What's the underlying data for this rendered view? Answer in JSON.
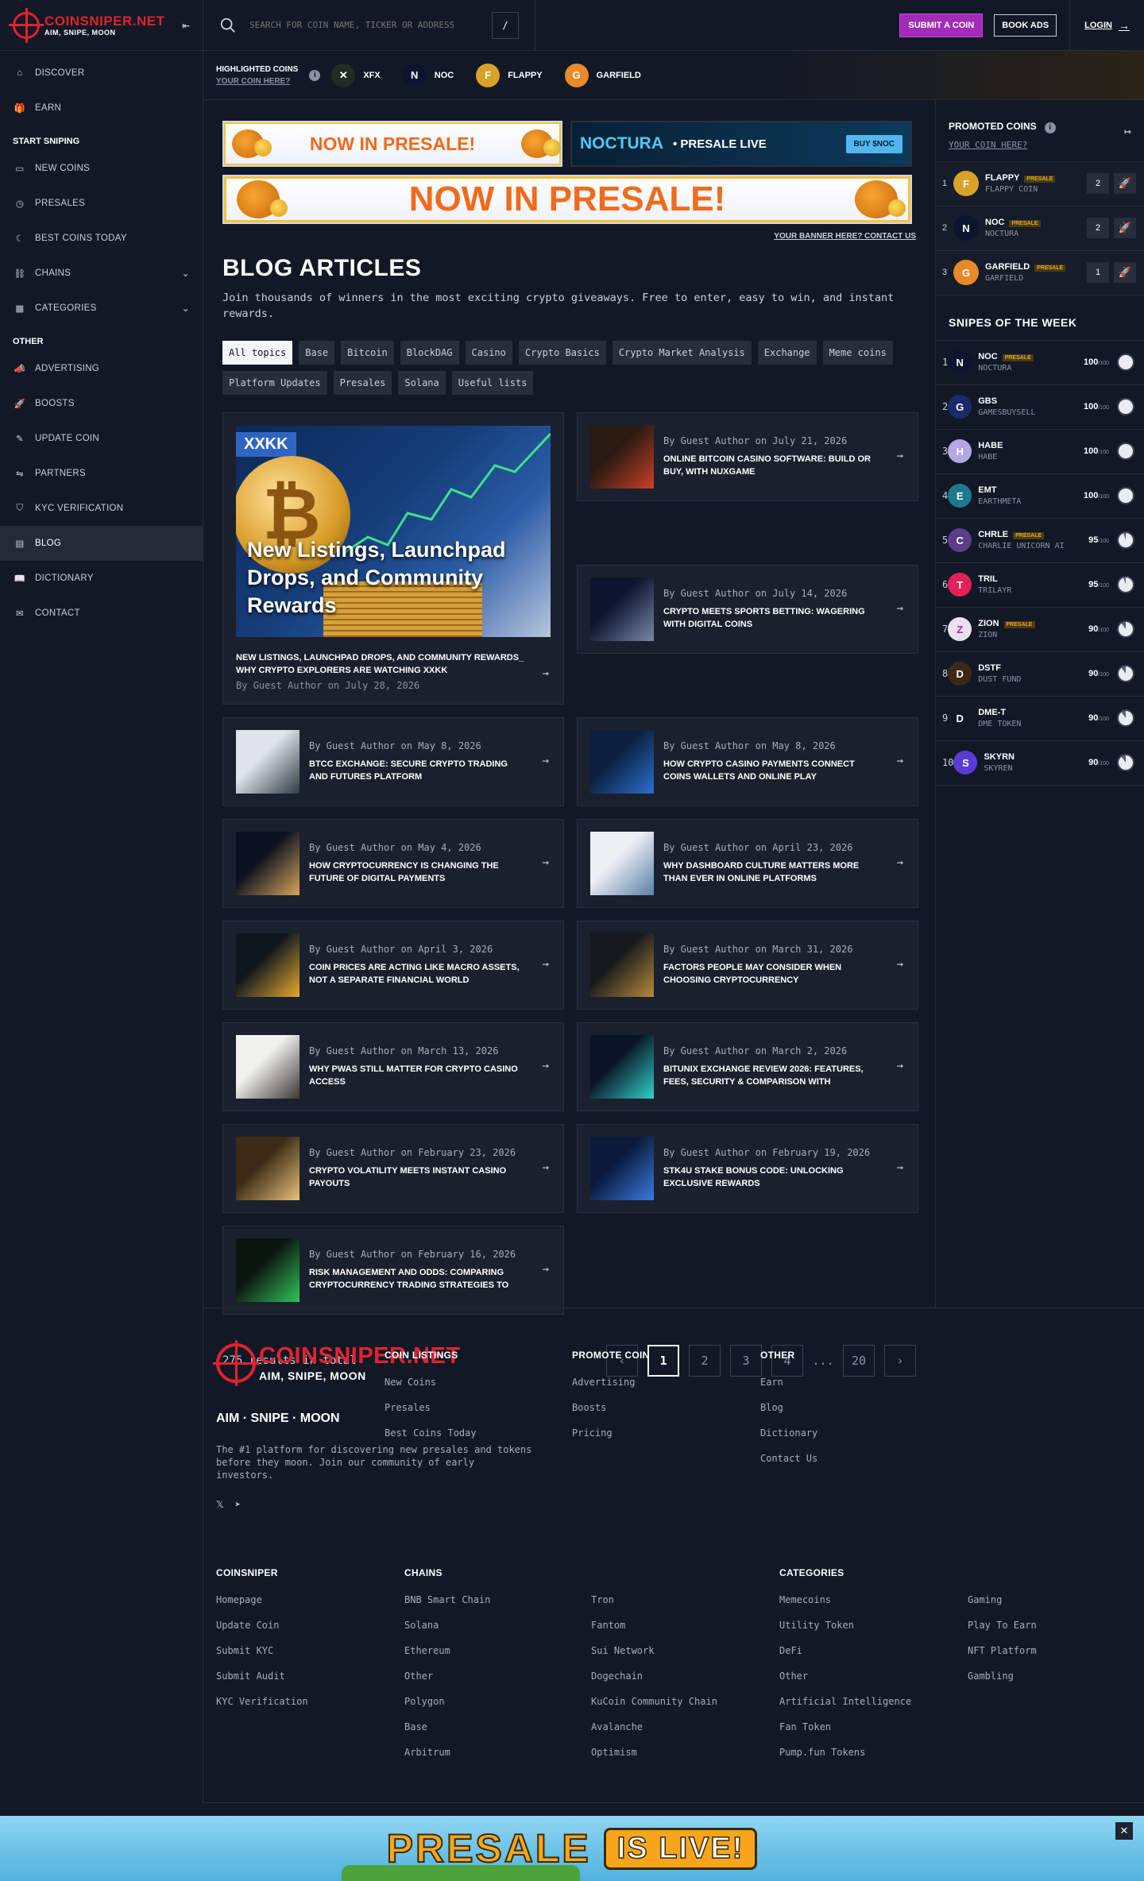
{
  "brand": {
    "name": "COINSNIPER.NET",
    "tagline": "AIM, SNIPE, MOON"
  },
  "sidebar": {
    "items_top": [
      {
        "label": "DISCOVER",
        "icon": "home-icon"
      },
      {
        "label": "EARN",
        "icon": "gift-icon"
      }
    ],
    "section_sniping": "START SNIPING",
    "items_sniping": [
      {
        "label": "NEW COINS",
        "icon": "new-icon"
      },
      {
        "label": "PRESALES",
        "icon": "stopwatch-icon"
      },
      {
        "label": "BEST COINS TODAY",
        "icon": "moon-icon"
      },
      {
        "label": "CHAINS",
        "icon": "link-icon"
      },
      {
        "label": "CATEGORIES",
        "icon": "grid-icon"
      }
    ],
    "section_other": "OTHER",
    "items_other": [
      {
        "label": "ADVERTISING",
        "icon": "megaphone-icon"
      },
      {
        "label": "BOOSTS",
        "icon": "rocket-icon"
      },
      {
        "label": "UPDATE COIN",
        "icon": "edit-icon"
      },
      {
        "label": "PARTNERS",
        "icon": "handshake-icon"
      },
      {
        "label": "KYC VERIFICATION",
        "icon": "shield-icon"
      },
      {
        "label": "BLOG",
        "icon": "document-icon"
      },
      {
        "label": "DICTIONARY",
        "icon": "book-icon"
      },
      {
        "label": "CONTACT",
        "icon": "mail-icon"
      }
    ]
  },
  "topbar": {
    "search_placeholder": "SEARCH FOR COIN NAME, TICKER OR ADDRESS",
    "search_shortcut": "/",
    "submit_label": "SUBMIT A COIN",
    "book_label": "BOOK ADS",
    "login_label": "LOGIN"
  },
  "highlighted": {
    "title": "HIGHLIGHTED COINS",
    "sub": "YOUR COIN HERE?",
    "coins": [
      {
        "name": "XFX",
        "color": "#1f2d22",
        "glyph": "✕"
      },
      {
        "name": "NOC",
        "color": "#0d1430",
        "glyph": "N"
      },
      {
        "name": "FLAPPY",
        "color": "#d8a328",
        "glyph": "F"
      },
      {
        "name": "GARFIELD",
        "color": "#e8892a",
        "glyph": "G"
      }
    ]
  },
  "banners": {
    "presale_small": "NOW IN PRESALE!",
    "noc_brand": "NOCTURA",
    "noc_live": "• PRESALE LIVE",
    "noc_buy": "BUY $NOC",
    "presale_big": "NOW IN PRESALE!",
    "banner_link": "YOUR BANNER HERE? CONTACT US"
  },
  "blog": {
    "title": "BLOG ARTICLES",
    "description": "Join thousands of winners in the most exciting crypto giveaways. Free to enter, easy to win, and instant rewards.",
    "topics": [
      "All topics",
      "Base",
      "Bitcoin",
      "BlockDAG",
      "Casino",
      "Crypto Basics",
      "Crypto Market Analysis",
      "Exchange",
      "Meme coins",
      "Platform Updates",
      "Presales",
      "Solana",
      "Useful lists"
    ],
    "featured": {
      "badge": "XXKK",
      "image_caption": "New Listings, Launchpad Drops, and Community Rewards",
      "title": "NEW LISTINGS, LAUNCHPAD DROPS, AND COMMUNITY REWARDS_ WHY CRYPTO EXPLORERS ARE WATCHING XXKK",
      "meta": "By Guest Author on July 28, 2026"
    },
    "articles": [
      {
        "meta": "By Guest Author on July 21, 2026",
        "title": "ONLINE BITCOIN CASINO SOFTWARE: BUILD OR BUY, WITH NUXGAME",
        "thumb": [
          "#2a1a10",
          "#c8402a"
        ]
      },
      {
        "meta": "By Guest Author on July 14, 2026",
        "title": "CRYPTO MEETS SPORTS BETTING: WAGERING WITH DIGITAL COINS",
        "thumb": [
          "#0d1530",
          "#7a86a8"
        ]
      },
      {
        "meta": "By Guest Author on May 8, 2026",
        "title": "BTCC EXCHANGE: SECURE CRYPTO TRADING AND FUTURES PLATFORM",
        "thumb": [
          "#dfe5ea",
          "#2f3a44"
        ]
      },
      {
        "meta": "By Guest Author on May 8, 2026",
        "title": "HOW CRYPTO CASINO PAYMENTS CONNECT COINS WALLETS AND ONLINE PLAY",
        "thumb": [
          "#0b1f3e",
          "#2c6fd0"
        ]
      },
      {
        "meta": "By Guest Author on May 4, 2026",
        "title": "HOW CRYPTOCURRENCY IS CHANGING THE FUTURE OF DIGITAL PAYMENTS",
        "thumb": [
          "#0a1020",
          "#d7a55a"
        ]
      },
      {
        "meta": "By Guest Author on April 23, 2026",
        "title": "WHY DASHBOARD CULTURE MATTERS MORE THAN EVER IN ONLINE PLATFORMS",
        "thumb": [
          "#eef1f4",
          "#5a7fa8"
        ]
      },
      {
        "meta": "By Guest Author on April 3, 2026",
        "title": "COIN PRICES ARE ACTING LIKE MACRO ASSETS, NOT A SEPARATE FINANCIAL WORLD",
        "thumb": [
          "#10161e",
          "#e6a92e"
        ]
      },
      {
        "meta": "By Guest Author on March 31, 2026",
        "title": "FACTORS PEOPLE MAY CONSIDER WHEN CHOOSING CRYPTOCURRENCY",
        "thumb": [
          "#15171c",
          "#b88a3a"
        ]
      },
      {
        "meta": "By Guest Author on March 13, 2026",
        "title": "WHY PWAS STILL MATTER FOR CRYPTO CASINO ACCESS",
        "thumb": [
          "#f1f1ef",
          "#3b3633"
        ]
      },
      {
        "meta": "By Guest Author on March 2, 2026",
        "title": "BITUNIX EXCHANGE REVIEW 2026: FEATURES, FEES, SECURITY & COMPARISON WITH",
        "thumb": [
          "#0a1426",
          "#2fd2c8"
        ]
      },
      {
        "meta": "By Guest Author on February 23, 2026",
        "title": "CRYPTO VOLATILITY MEETS INSTANT CASINO PAYOUTS",
        "thumb": [
          "#3b2a15",
          "#e8c27a"
        ]
      },
      {
        "meta": "By Guest Author on February 19, 2026",
        "title": "STK4U STAKE BONUS CODE: UNLOCKING EXCLUSIVE REWARDS",
        "thumb": [
          "#0a1a3a",
          "#3a7ae0"
        ]
      },
      {
        "meta": "By Guest Author on February 16, 2026",
        "title": "RISK MANAGEMENT AND ODDS: COMPARING CRYPTOCURRENCY TRADING STRATEGIES TO",
        "thumb": [
          "#0c1410",
          "#33c45a"
        ]
      }
    ],
    "results": "275 results in total",
    "pages": [
      "1",
      "2",
      "3",
      "4",
      "...",
      "20"
    ]
  },
  "promoted": {
    "title": "PROMOTED COINS",
    "sub": "YOUR COIN HERE?",
    "tag": "PRESALE",
    "rows": [
      {
        "rank": "1",
        "name": "FLAPPY",
        "full": "FLAPPY COIN",
        "votes": "2",
        "presale": true,
        "color": "#d8a328",
        "glyph": "F"
      },
      {
        "rank": "2",
        "name": "NOC",
        "full": "NOCTURA",
        "votes": "2",
        "presale": true,
        "color": "#0d1430",
        "glyph": "N"
      },
      {
        "rank": "3",
        "name": "GARFIELD",
        "full": "GARFIELD",
        "votes": "1",
        "presale": true,
        "color": "#e8892a",
        "glyph": "G"
      }
    ]
  },
  "snipes": {
    "title": "SNIPES OF THE WEEK",
    "max": "/100",
    "tag": "PRESALE",
    "rows": [
      {
        "rank": "1",
        "name": "NOC",
        "full": "NOCTURA",
        "score": 100,
        "presale": true,
        "color": "#0d1430",
        "glyph": "N"
      },
      {
        "rank": "2",
        "name": "GBS",
        "full": "GAMESBUYSELL",
        "score": 100,
        "presale": false,
        "color": "#1a2a6a",
        "glyph": "G"
      },
      {
        "rank": "3",
        "name": "HABE",
        "full": "HABE",
        "score": 100,
        "presale": false,
        "color": "#b3a7e6",
        "glyph": "H"
      },
      {
        "rank": "4",
        "name": "EMT",
        "full": "EARTHMETA",
        "score": 100,
        "presale": false,
        "color": "#1d7a8a",
        "glyph": "E"
      },
      {
        "rank": "5",
        "name": "CHRLE",
        "full": "CHARLIE UNICORN AI",
        "score": 95,
        "presale": true,
        "color": "#5b3d8a",
        "glyph": "C"
      },
      {
        "rank": "6",
        "name": "TRIL",
        "full": "TRILAYR",
        "score": 95,
        "presale": false,
        "color": "#e2205a",
        "glyph": "T"
      },
      {
        "rank": "7",
        "name": "ZION",
        "full": "ZION",
        "score": 90,
        "presale": true,
        "color": "#e8e1f4",
        "glyph": "Z"
      },
      {
        "rank": "8",
        "name": "DSTF",
        "full": "DUST FUND",
        "score": 90,
        "presale": false,
        "color": "#3a2a15",
        "glyph": "D"
      },
      {
        "rank": "9",
        "name": "DME-T",
        "full": "DME TOKEN",
        "score": 90,
        "presale": false,
        "color": "#121826",
        "glyph": "D"
      },
      {
        "rank": "10",
        "name": "SKYRN",
        "full": "SKYREN",
        "score": 90,
        "presale": false,
        "color": "#5a3ad6",
        "glyph": "S"
      }
    ]
  },
  "footer": {
    "tagline": "AIM · SNIPE · MOON",
    "description": "The #1 platform for discovering new presales and tokens before they moon. Join our community of early investors.",
    "social": [
      {
        "icon": "x-icon",
        "glyph": "𝕏"
      },
      {
        "icon": "telegram-icon",
        "glyph": "➤"
      }
    ],
    "columns_top": [
      {
        "title": "COIN LISTINGS",
        "links": [
          "New Coins",
          "Presales",
          "Best Coins Today"
        ]
      },
      {
        "title": "PROMOTE COIN",
        "links": [
          "Advertising",
          "Boosts",
          "Pricing"
        ]
      },
      {
        "title": "OTHER",
        "links": [
          "Earn",
          "Blog",
          "Dictionary",
          "Contact Us"
        ]
      }
    ],
    "columns_bottom": [
      {
        "title": "COINSNIPER",
        "links": [
          "Homepage",
          "Update Coin",
          "Submit KYC",
          "Submit Audit",
          "KYC Verification"
        ]
      },
      {
        "title": "CHAINS",
        "links": [
          "BNB Smart Chain",
          "Solana",
          "Ethereum",
          "Other",
          "Polygon",
          "Base",
          "Arbitrum"
        ]
      },
      {
        "title": "",
        "links": [
          "Tron",
          "Fantom",
          "Sui Network",
          "Dogechain",
          "KuCoin Community Chain",
          "Avalanche",
          "Optimism"
        ]
      },
      {
        "title": "CATEGORIES",
        "links": [
          "Memecoins",
          "Utility Token",
          "DeFi",
          "Other",
          "Artificial Intelligence",
          "Fan Token",
          "Pump.fun Tokens"
        ]
      },
      {
        "title": "",
        "links": [
          "Gaming",
          "Play To Earn",
          "NFT Platform",
          "Gambling"
        ]
      }
    ]
  },
  "bottom_ad": {
    "word1": "PRESALE",
    "word2": "IS LIVE!",
    "close": "✕"
  }
}
